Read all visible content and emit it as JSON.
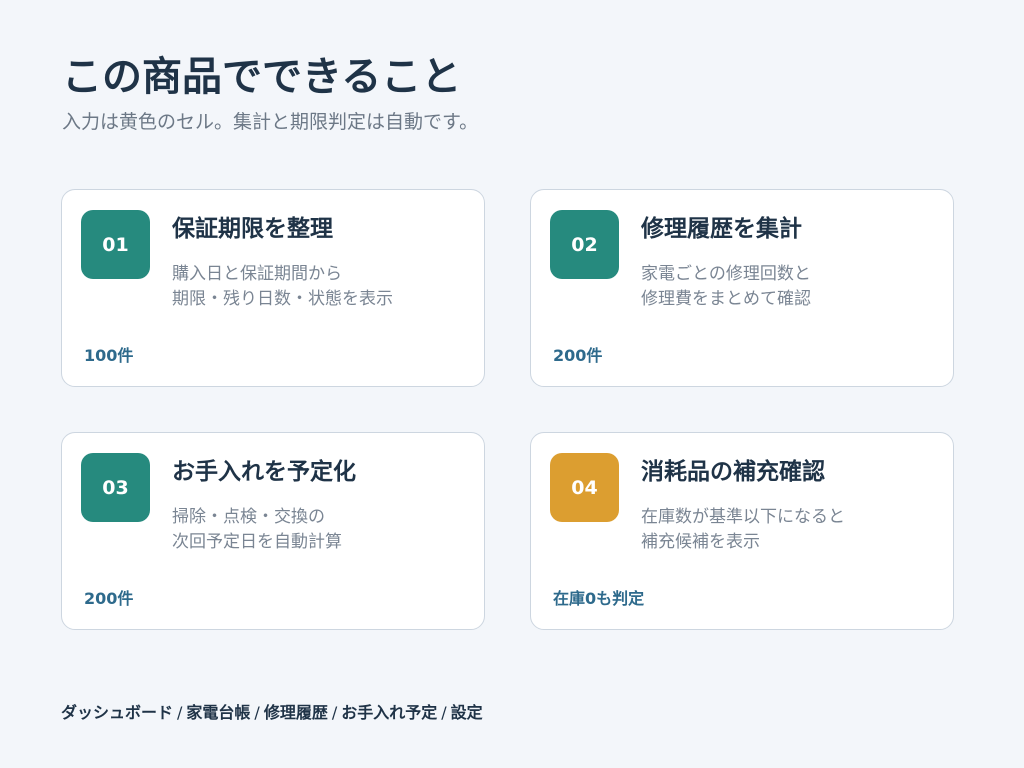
{
  "header": {
    "title": "この商品でできること",
    "subtitle": "入力は黄色のセル。集計と期限判定は自動です。"
  },
  "colors": {
    "background": "#f3f6fa",
    "teal": "#268a7e",
    "amber": "#dc9e30",
    "title_text": "#1f3347",
    "desc_text": "#7a8593",
    "foot_text": "#2e6a8c"
  },
  "cards": [
    {
      "number": "01",
      "title": "保証期限を整理",
      "desc": [
        "購入日と保証期間から",
        "期限・残り日数・状態を表示"
      ],
      "foot": "100件",
      "badge_color": "teal"
    },
    {
      "number": "02",
      "title": "修理履歴を集計",
      "desc": [
        "家電ごとの修理回数と",
        "修理費をまとめて確認"
      ],
      "foot": "200件",
      "badge_color": "teal"
    },
    {
      "number": "03",
      "title": "お手入れを予定化",
      "desc": [
        "掃除・点検・交換の",
        "次回予定日を自動計算"
      ],
      "foot": "200件",
      "badge_color": "teal"
    },
    {
      "number": "04",
      "title": "消耗品の補充確認",
      "desc": [
        "在庫数が基準以下になると",
        "補充候補を表示"
      ],
      "foot": "在庫0も判定",
      "badge_color": "amber"
    }
  ],
  "nav": {
    "separator": "/",
    "items": [
      "ダッシュボード",
      "家電台帳",
      "修理履歴",
      "お手入れ予定",
      "設定"
    ]
  }
}
